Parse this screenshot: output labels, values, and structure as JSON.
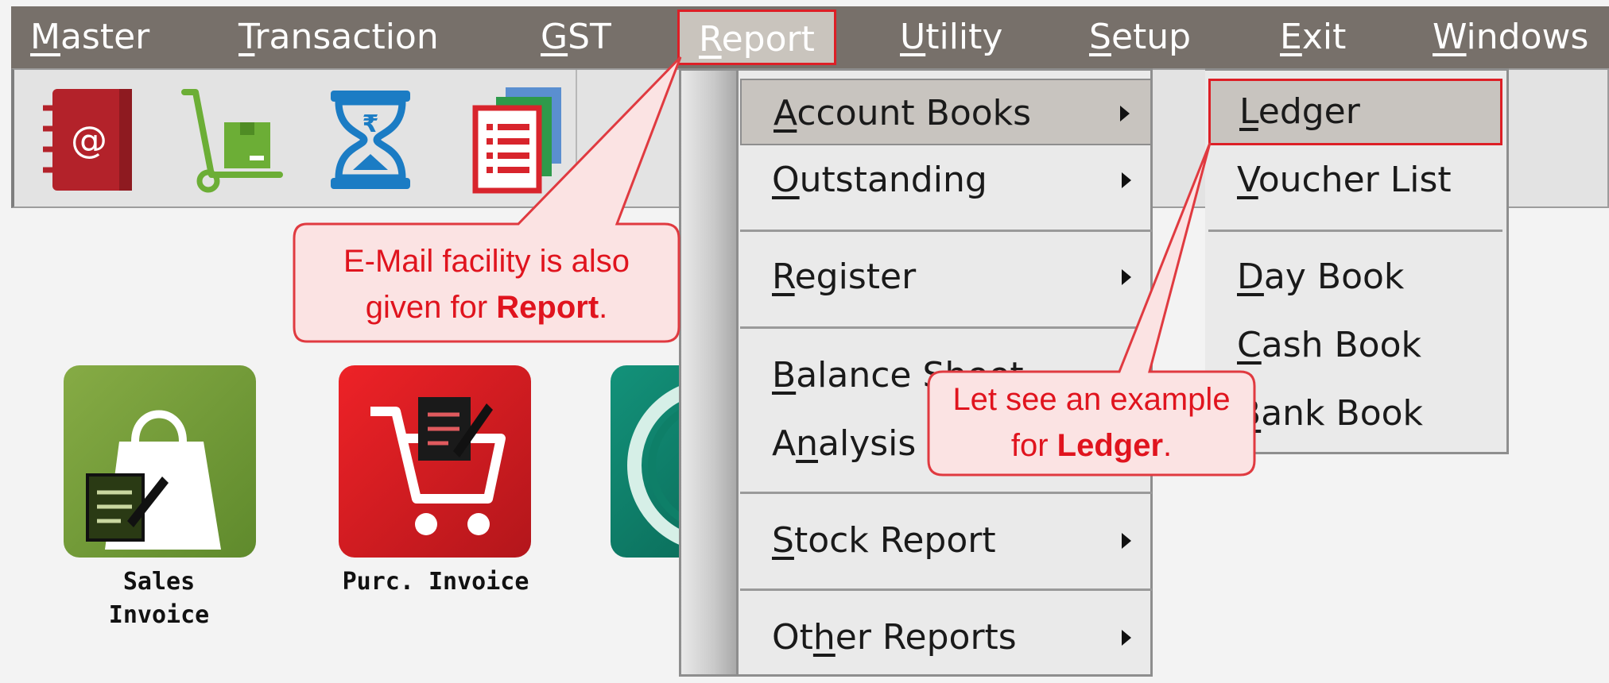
{
  "menubar": {
    "items": [
      {
        "label": "Master",
        "key": "M"
      },
      {
        "label": "Transaction",
        "key": "T"
      },
      {
        "label": "GST",
        "key": "G"
      },
      {
        "label": "Report",
        "key": "R"
      },
      {
        "label": "Utility",
        "key": "U"
      },
      {
        "label": "Setup",
        "key": "S"
      },
      {
        "label": "Exit",
        "key": "E"
      },
      {
        "label": "Windows",
        "key": "W"
      }
    ],
    "active_index": 3
  },
  "toolbar": {
    "icons": [
      "address-book-icon",
      "trolley-icon",
      "hourglass-rupee-icon",
      "documents-list-icon"
    ]
  },
  "desktop": {
    "tiles": [
      {
        "icon": "shopping-bag-icon",
        "label_line1": "Sales",
        "label_line2": "Invoice"
      },
      {
        "icon": "shopping-cart-icon",
        "label_line1": "Purc. Invoice",
        "label_line2": ""
      },
      {
        "icon": "currency-circle-icon",
        "label_line1": "",
        "label_line2": ""
      }
    ]
  },
  "report_menu": {
    "items": [
      {
        "label": "Account Books",
        "underline": "A",
        "has_submenu": true,
        "highlighted": true
      },
      {
        "label": "Outstanding",
        "underline": "O",
        "has_submenu": true
      },
      {
        "label": "Register",
        "underline": "R",
        "has_submenu": true
      },
      {
        "label": "Balance Sheet",
        "underline": "B",
        "has_submenu": false
      },
      {
        "label": "Analysis",
        "underline": "n",
        "has_submenu": false
      },
      {
        "label": "Stock Report",
        "underline": "S",
        "has_submenu": true
      },
      {
        "label": "Other Reports",
        "underline": "h",
        "has_submenu": true
      }
    ]
  },
  "account_books_submenu": {
    "items": [
      {
        "label": "Ledger",
        "underline": "L",
        "highlighted": true
      },
      {
        "label": "Voucher List",
        "underline": "V"
      },
      {
        "label": "Day Book",
        "underline": "D"
      },
      {
        "label": "Cash Book",
        "underline": "C"
      },
      {
        "label": "Bank Book",
        "underline": "B"
      }
    ]
  },
  "callouts": {
    "report": {
      "line1": "E-Mail facility is also",
      "line2_prefix": "given for ",
      "line2_bold": "Report",
      "line2_suffix": "."
    },
    "ledger": {
      "line1": "Let see an example",
      "line2_prefix": "for ",
      "line2_bold": "Ledger",
      "line2_suffix": "."
    }
  },
  "colors": {
    "menubar_bg": "#77706a",
    "highlight_border": "#dd1f26",
    "callout_text": "#e0141e",
    "callout_fill": "#fbe3e3"
  }
}
